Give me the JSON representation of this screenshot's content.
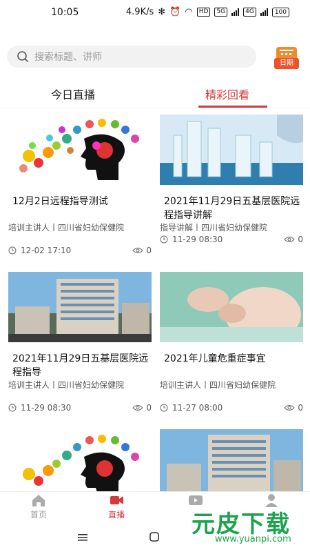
{
  "status": {
    "time": "10:05",
    "speed": "4.9K/s",
    "hd": "HD",
    "net1": "5G",
    "net2": "4G",
    "battery": "100"
  },
  "search": {
    "placeholder": "搜索标题、讲师"
  },
  "calendar": {
    "label": "日期"
  },
  "tabs": [
    {
      "label": "今日直播"
    },
    {
      "label": "精彩回看"
    }
  ],
  "cards": [
    {
      "title": "12月2日远程指导测试",
      "meta": "培训主讲人丨四川省妇幼保健院",
      "time": "12-02 17:10",
      "views": "0"
    },
    {
      "title": "2021年11月29日五基层医院远程指导讲解",
      "meta": "指导讲解丨四川省妇幼保健院",
      "time": "11-29 08:30",
      "views": "0"
    },
    {
      "title": "2021年11月29日五基层医院远程指导",
      "meta": "培训主讲人丨四川省妇幼保健院",
      "time": "11-29 08:30",
      "views": "0"
    },
    {
      "title": "2021年儿童危重症事宜",
      "meta": "培训主讲人丨四川省妇幼保健院",
      "time": "11-27 08:00",
      "views": "0"
    }
  ],
  "nav": [
    {
      "label": "首页"
    },
    {
      "label": "直播"
    },
    {
      "label": ""
    },
    {
      "label": ""
    }
  ],
  "watermark": {
    "main": "元皮下载",
    "sub": "www.yuanpi.com"
  },
  "colors": {
    "accent": "#d23b3b",
    "search_bg": "#f2f2f2"
  }
}
